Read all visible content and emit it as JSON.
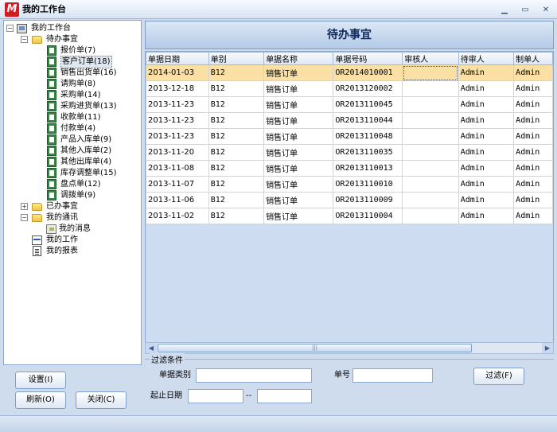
{
  "window": {
    "logo_text": "M",
    "title": "我的工作台",
    "minimize": "▁",
    "maximize": "▭",
    "close": "✕"
  },
  "tree": {
    "root": "我的工作台",
    "pending": "待办事宜",
    "pending_items": [
      "报价单(7)",
      "客户订单(18)",
      "销售出货单(16)",
      "请购单(8)",
      "采购单(14)",
      "采购进货单(13)",
      "收款单(11)",
      "付款单(4)",
      "产品入库单(9)",
      "其他入库单(2)",
      "其他出库单(4)",
      "库存调整单(15)",
      "盘点单(12)",
      "调拨单(9)"
    ],
    "done": "已办事宜",
    "comms": "我的通讯",
    "messages": "我的消息",
    "work": "我的工作",
    "reports": "我的报表",
    "expander_minus": "−",
    "expander_plus": "+"
  },
  "buttons": {
    "settings": "设置(I)",
    "refresh": "刷新(O)",
    "close": "关闭(C)",
    "filter": "过滤(F)"
  },
  "main": {
    "header": "待办事宜",
    "columns": [
      "单据日期",
      "单别",
      "单据名称",
      "单据号码",
      "审核人",
      "待审人",
      "制单人"
    ],
    "rows": [
      [
        "2014-01-03",
        "B12",
        "销售订单",
        "OR2014010001",
        "",
        "Admin",
        "Admin"
      ],
      [
        "2013-12-18",
        "B12",
        "销售订单",
        "OR2013120002",
        "",
        "Admin",
        "Admin"
      ],
      [
        "2013-11-23",
        "B12",
        "销售订单",
        "OR2013110045",
        "",
        "Admin",
        "Admin"
      ],
      [
        "2013-11-23",
        "B12",
        "销售订单",
        "OR2013110044",
        "",
        "Admin",
        "Admin"
      ],
      [
        "2013-11-23",
        "B12",
        "销售订单",
        "OR2013110048",
        "",
        "Admin",
        "Admin"
      ],
      [
        "2013-11-20",
        "B12",
        "销售订单",
        "OR2013110035",
        "",
        "Admin",
        "Admin"
      ],
      [
        "2013-11-08",
        "B12",
        "销售订单",
        "OR2013110013",
        "",
        "Admin",
        "Admin"
      ],
      [
        "2013-11-07",
        "B12",
        "销售订单",
        "OR2013110010",
        "",
        "Admin",
        "Admin"
      ],
      [
        "2013-11-06",
        "B12",
        "销售订单",
        "OR2013110009",
        "",
        "Admin",
        "Admin"
      ],
      [
        "2013-11-02",
        "B12",
        "销售订单",
        "OR2013110004",
        "",
        "Admin",
        "Admin"
      ]
    ],
    "selected_row": 0,
    "scroll_left": "◀",
    "scroll_right": "▶",
    "scroll_grip": "|||"
  },
  "filter": {
    "legend": "过滤条件",
    "doc_type_label": "单据类别",
    "doc_type_value": "",
    "doc_no_label": "单号",
    "doc_no_value": "",
    "date_range_label": "起止日期",
    "date_from_value": "",
    "date_sep": "--",
    "date_to_value": ""
  },
  "colors": {
    "selected_row": "#fbe0a6",
    "header_text": "#10285a",
    "logo_red": "#d71920"
  }
}
